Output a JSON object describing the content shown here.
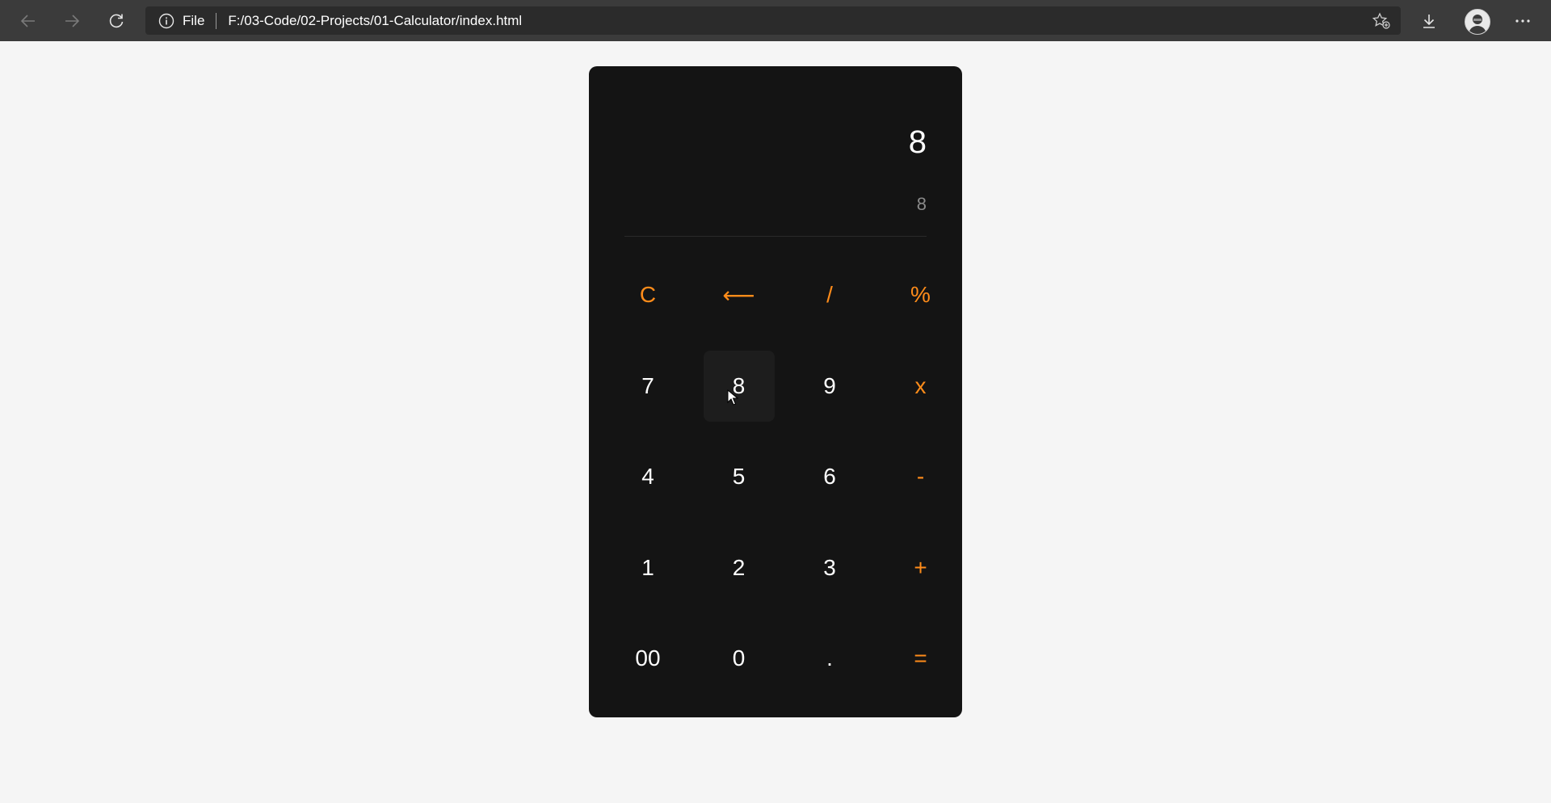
{
  "browser": {
    "address_scheme": "File",
    "address_url": "F:/03-Code/02-Projects/01-Calculator/index.html",
    "icons": {
      "back": "back-arrow-icon",
      "forward": "forward-arrow-icon",
      "refresh": "refresh-icon",
      "info": "info-icon",
      "favorite": "add-favorite-icon",
      "downloads": "download-icon",
      "profile": "avatar",
      "menu": "more-menu-icon"
    }
  },
  "calculator": {
    "display_main": "8",
    "display_sub": "8",
    "colors": {
      "background": "#141414",
      "operator": "#ff8c1a",
      "digit": "#ffffff",
      "secondary": "#8a8a8a"
    },
    "keys": [
      {
        "label": "C",
        "type": "op"
      },
      {
        "label": "⟵",
        "type": "op"
      },
      {
        "label": "/",
        "type": "op"
      },
      {
        "label": "%",
        "type": "op"
      },
      {
        "label": "7",
        "type": "digit"
      },
      {
        "label": "8",
        "type": "digit",
        "hovered": true
      },
      {
        "label": "9",
        "type": "digit"
      },
      {
        "label": "x",
        "type": "op"
      },
      {
        "label": "4",
        "type": "digit"
      },
      {
        "label": "5",
        "type": "digit"
      },
      {
        "label": "6",
        "type": "digit"
      },
      {
        "label": "-",
        "type": "op"
      },
      {
        "label": "1",
        "type": "digit"
      },
      {
        "label": "2",
        "type": "digit"
      },
      {
        "label": "3",
        "type": "digit"
      },
      {
        "label": "+",
        "type": "op"
      },
      {
        "label": "00",
        "type": "digit"
      },
      {
        "label": "0",
        "type": "digit"
      },
      {
        "label": ".",
        "type": "digit"
      },
      {
        "label": "=",
        "type": "op"
      }
    ]
  }
}
